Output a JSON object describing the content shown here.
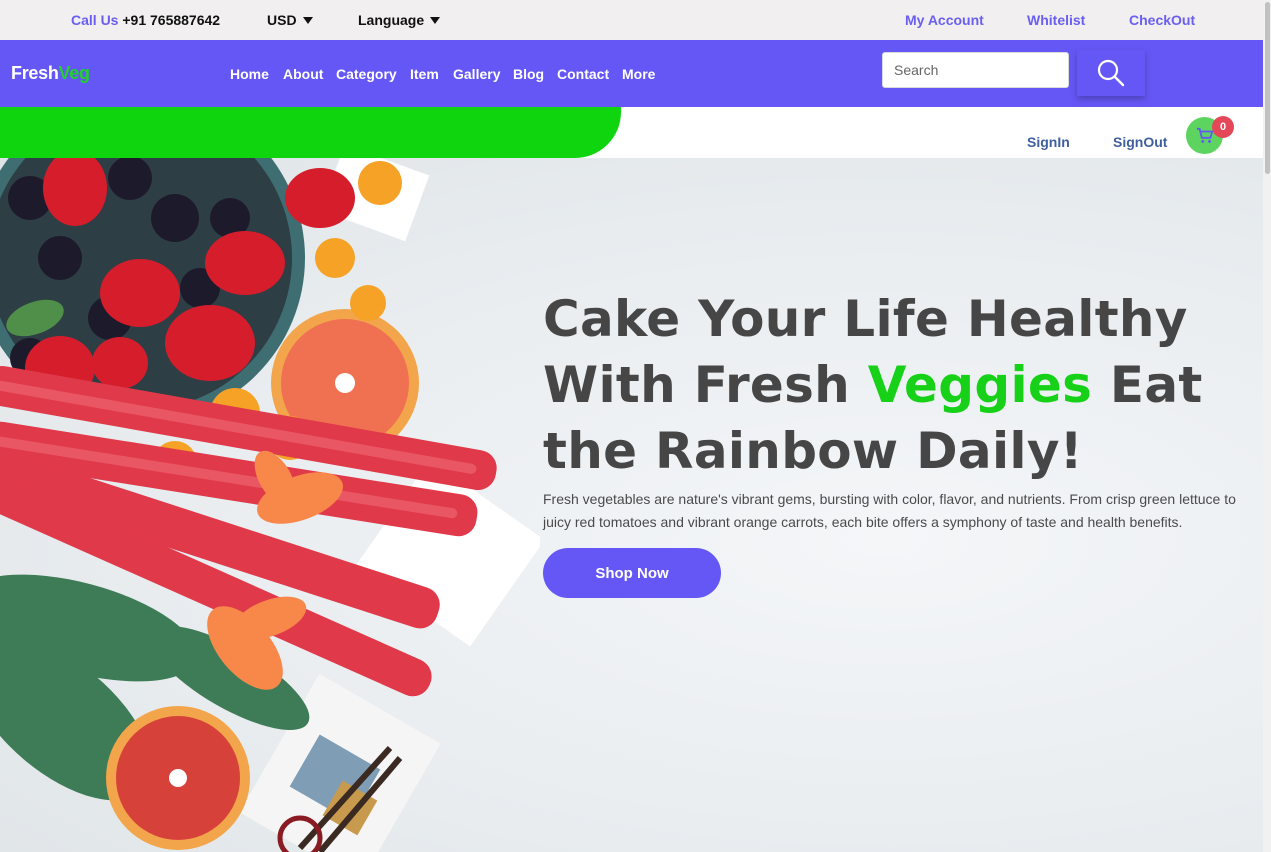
{
  "topbar": {
    "call_label": "Call Us",
    "phone": "+91 765887642",
    "currency": "USD",
    "language": "Language",
    "my_account": "My Account",
    "whitelist": "Whitelist",
    "checkout": "CheckOut"
  },
  "brand": {
    "part1": "Fresh",
    "part2": "Veg"
  },
  "nav": {
    "items": [
      "Home",
      "About",
      "Category",
      "Item",
      "Gallery",
      "Blog",
      "Contact",
      "More"
    ]
  },
  "search": {
    "placeholder": "Search"
  },
  "account": {
    "signin": "SignIn",
    "signout": "SignOut",
    "cart_count": "0"
  },
  "hero": {
    "headline_part1": "Cake Your Life Healthy With Fresh ",
    "headline_highlight": "Veggies",
    "headline_part2": " Eat the Rainbow Daily!",
    "description": "Fresh vegetables are nature's vibrant gems, bursting with color, flavor, and nutrients. From crisp green lettuce to juicy red tomatoes and vibrant orange carrots, each bite offers a symphony of taste and health benefits.",
    "cta": "Shop Now"
  },
  "colors": {
    "brand_purple": "#6557f5",
    "brand_green": "#0fd50f",
    "accent_link": "#6a5ff0",
    "badge_red": "#e34758"
  },
  "icons": [
    "caret-down-icon",
    "search-icon",
    "cart-icon"
  ]
}
